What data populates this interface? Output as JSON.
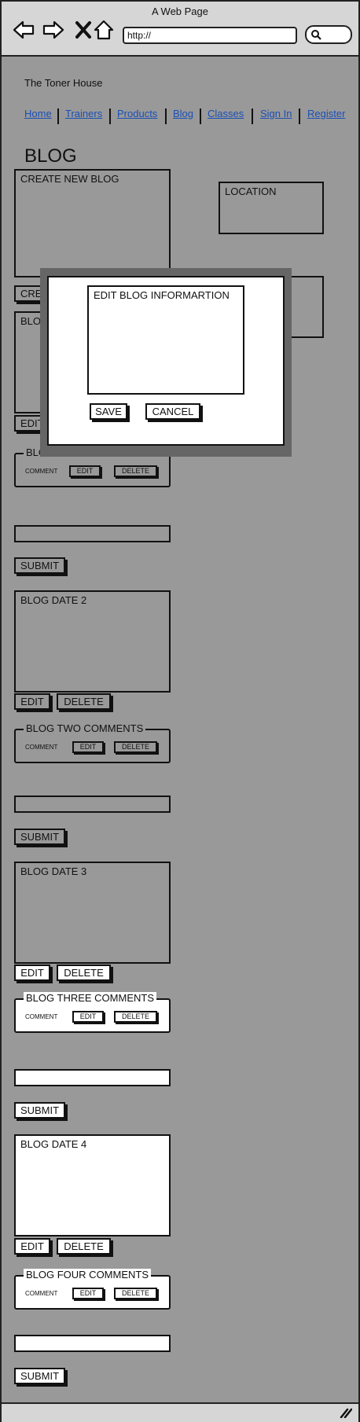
{
  "window": {
    "title": "A Web Page",
    "url": "http://"
  },
  "site": {
    "name": "The Toner House",
    "nav": [
      "Home",
      "Trainers",
      "Products",
      "Blog",
      "Classes",
      "Sign In",
      "Register"
    ]
  },
  "page": {
    "heading": "BLOG"
  },
  "create_blog": {
    "label": "CREATE NEW BLOG",
    "button_partial": "CREA"
  },
  "location": {
    "label": "LOCATION"
  },
  "modal": {
    "title": "EDIT BLOG INFORMARTION",
    "save": "SAVE",
    "cancel": "CANCEL"
  },
  "blog1": {
    "date_partial": "BLOG",
    "edit": "EDIT",
    "comments_legend": "BLOG ONE COMMENTS",
    "comment": "COMMENT",
    "c_edit": "EDIT",
    "c_delete": "DELETE",
    "submit": "SUBMIT"
  },
  "blog2": {
    "date": "BLOG DATE 2",
    "edit": "EDIT",
    "delete": "DELETE",
    "comments_legend": "BLOG TWO COMMENTS",
    "comment": "COMMENT",
    "c_edit": "EDIT",
    "c_delete": "DELETE",
    "submit": "SUBMIT"
  },
  "blog3": {
    "date": "BLOG DATE 3",
    "edit": "EDIT",
    "delete": "DELETE",
    "comments_legend": "BLOG THREE COMMENTS",
    "comment": "COMMENT",
    "c_edit": "EDIT",
    "c_delete": "DELETE",
    "submit": "SUBMIT"
  },
  "blog4": {
    "date": "BLOG DATE 4",
    "edit": "EDIT",
    "delete": "DELETE",
    "comments_legend": "BLOG FOUR COMMENTS",
    "comment": "COMMENT",
    "c_edit": "EDIT",
    "c_delete": "DELETE",
    "submit": "SUBMIT"
  },
  "colors": {
    "page_bg": "#999999",
    "link": "#1a4fb5",
    "overlay": "#666666",
    "chrome": "#d6d6d6"
  }
}
